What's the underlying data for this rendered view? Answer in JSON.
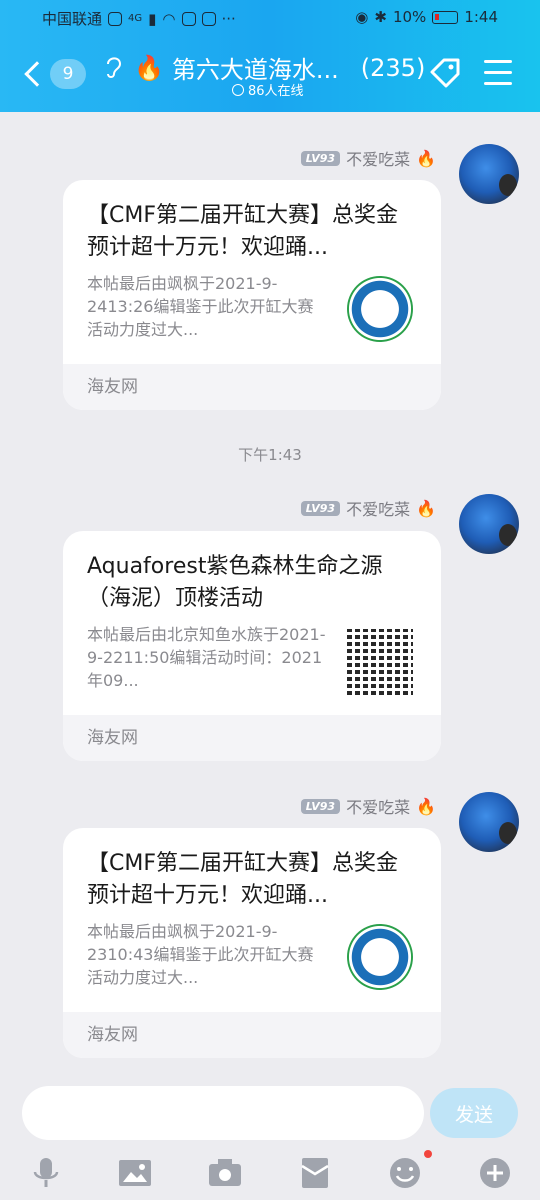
{
  "status_bar": {
    "carrier": "中国联通",
    "network": "4G",
    "battery": "10%",
    "time": "1:44"
  },
  "header": {
    "unread_count": "9",
    "title": "第六大道海水...",
    "member_count": "(235)",
    "online": "86人在线"
  },
  "messages": [
    {
      "sender_level": "LV93",
      "sender_name": "不爱吃菜",
      "card_title": "【CMF第二届开缸大赛】总奖金预计超十万元！欢迎踊...",
      "card_desc": "本帖最后由飒枫于2021-9-2413:26编辑鉴于此次开缸大赛活动力度过大...",
      "card_source": "海友网",
      "thumb": "logo"
    },
    {
      "sender_level": "LV93",
      "sender_name": "不爱吃菜",
      "card_title": "Aquaforest紫色森林生命之源（海泥）顶楼活动",
      "card_desc": "本帖最后由北京知鱼水族于2021-9-2211:50编辑活动时间：2021年09...",
      "card_source": "海友网",
      "thumb": "qr"
    },
    {
      "sender_level": "LV93",
      "sender_name": "不爱吃菜",
      "card_title": "【CMF第二届开缸大赛】总奖金预计超十万元！欢迎踊...",
      "card_desc": "本帖最后由飒枫于2021-9-2310:43编辑鉴于此次开缸大赛活动力度过大...",
      "card_source": "海友网",
      "thumb": "logo"
    }
  ],
  "timestamp": "下午1:43",
  "input": {
    "placeholder": "",
    "send_label": "发送"
  },
  "toolbar_icons": [
    "microphone-icon",
    "image-icon",
    "camera-icon",
    "red-packet-icon",
    "emoji-icon",
    "plus-icon"
  ],
  "colors": {
    "header_accent": "#1aa6f0",
    "send_button": "#bfe4f7",
    "notification_dot": "#f2453d"
  }
}
